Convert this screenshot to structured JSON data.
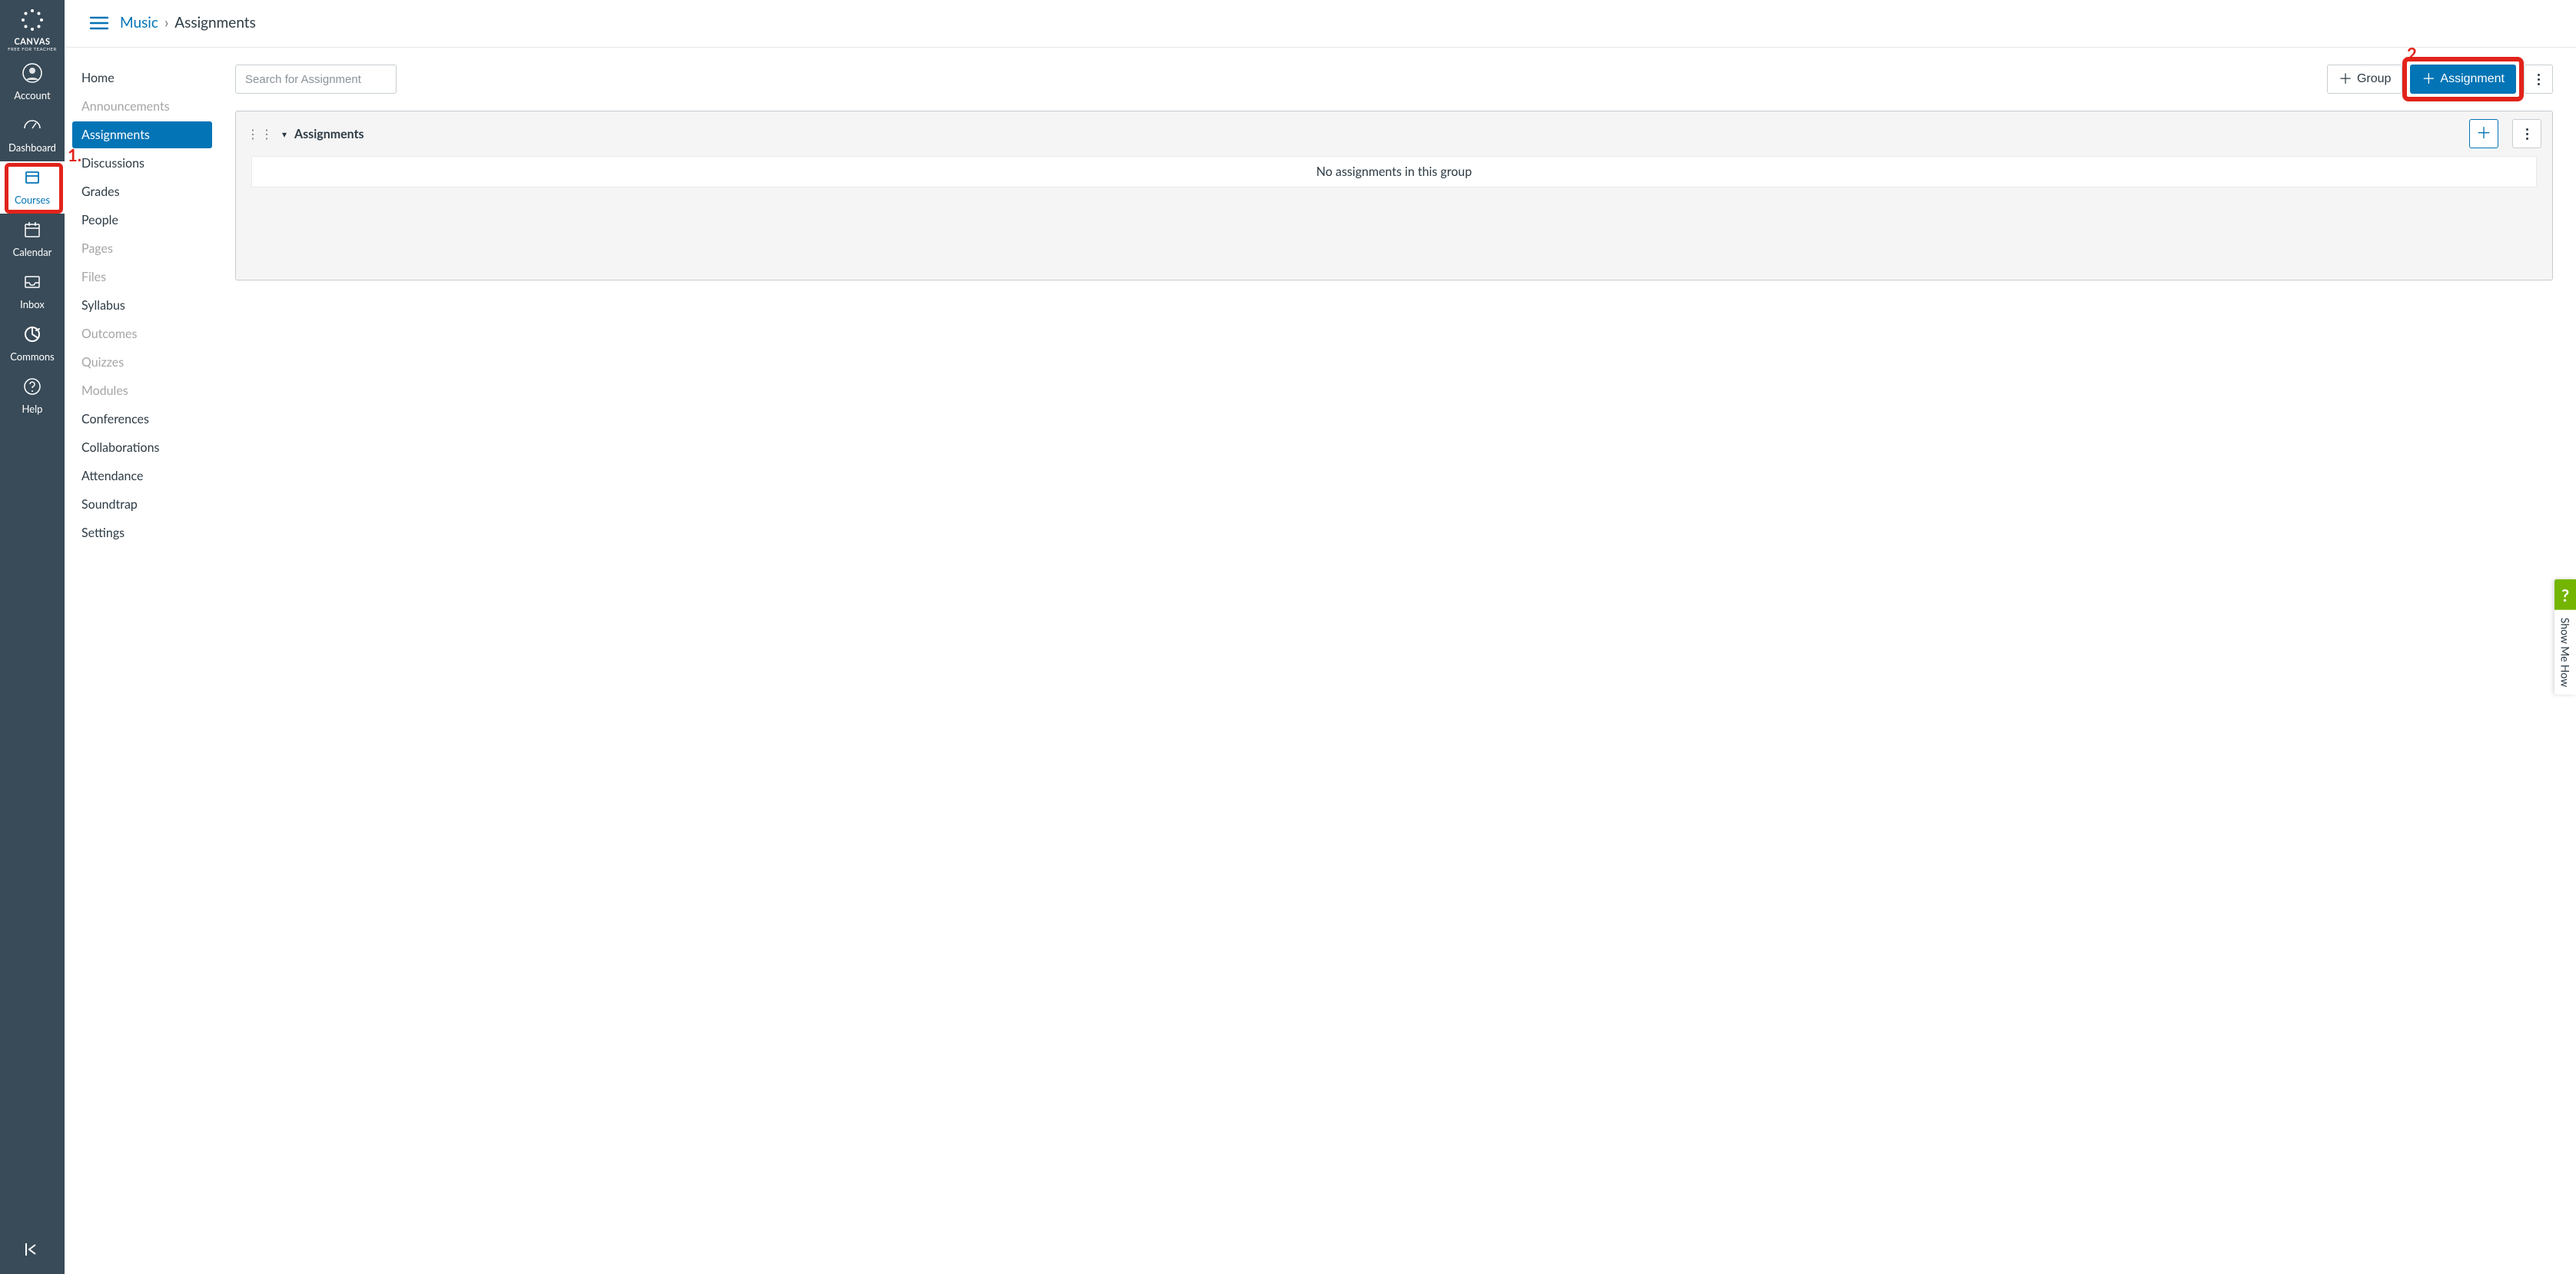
{
  "brand": {
    "name": "CANVAS",
    "subtitle": "FREE FOR TEACHER"
  },
  "global_nav": [
    {
      "key": "account",
      "label": "Account",
      "icon": "user-circle-icon"
    },
    {
      "key": "dashboard",
      "label": "Dashboard",
      "icon": "dashboard-icon"
    },
    {
      "key": "courses",
      "label": "Courses",
      "icon": "courses-icon",
      "active": true
    },
    {
      "key": "calendar",
      "label": "Calendar",
      "icon": "calendar-icon"
    },
    {
      "key": "inbox",
      "label": "Inbox",
      "icon": "inbox-icon"
    },
    {
      "key": "commons",
      "label": "Commons",
      "icon": "commons-icon"
    },
    {
      "key": "help",
      "label": "Help",
      "icon": "help-icon"
    }
  ],
  "breadcrumb": {
    "course": "Music",
    "page": "Assignments"
  },
  "course_nav": [
    {
      "label": "Home"
    },
    {
      "label": "Announcements",
      "disabled": true
    },
    {
      "label": "Assignments",
      "active": true
    },
    {
      "label": "Discussions"
    },
    {
      "label": "Grades"
    },
    {
      "label": "People"
    },
    {
      "label": "Pages",
      "disabled": true
    },
    {
      "label": "Files",
      "disabled": true
    },
    {
      "label": "Syllabus"
    },
    {
      "label": "Outcomes",
      "disabled": true
    },
    {
      "label": "Quizzes",
      "disabled": true
    },
    {
      "label": "Modules",
      "disabled": true
    },
    {
      "label": "Conferences"
    },
    {
      "label": "Collaborations"
    },
    {
      "label": "Attendance"
    },
    {
      "label": "Soundtrap"
    },
    {
      "label": "Settings"
    }
  ],
  "toolbar": {
    "search_placeholder": "Search for Assignment",
    "group_button": "Group",
    "assignment_button": "Assignment"
  },
  "group": {
    "title": "Assignments",
    "empty_text": "No assignments in this group"
  },
  "annotations": {
    "one": "1.",
    "two": "2."
  },
  "help_tab": {
    "label": "Show Me How",
    "q": "?"
  },
  "colors": {
    "primary": "#0374B5",
    "accent_red": "#E2231A",
    "nav_bg": "#394B58",
    "help_green": "#73B500"
  }
}
